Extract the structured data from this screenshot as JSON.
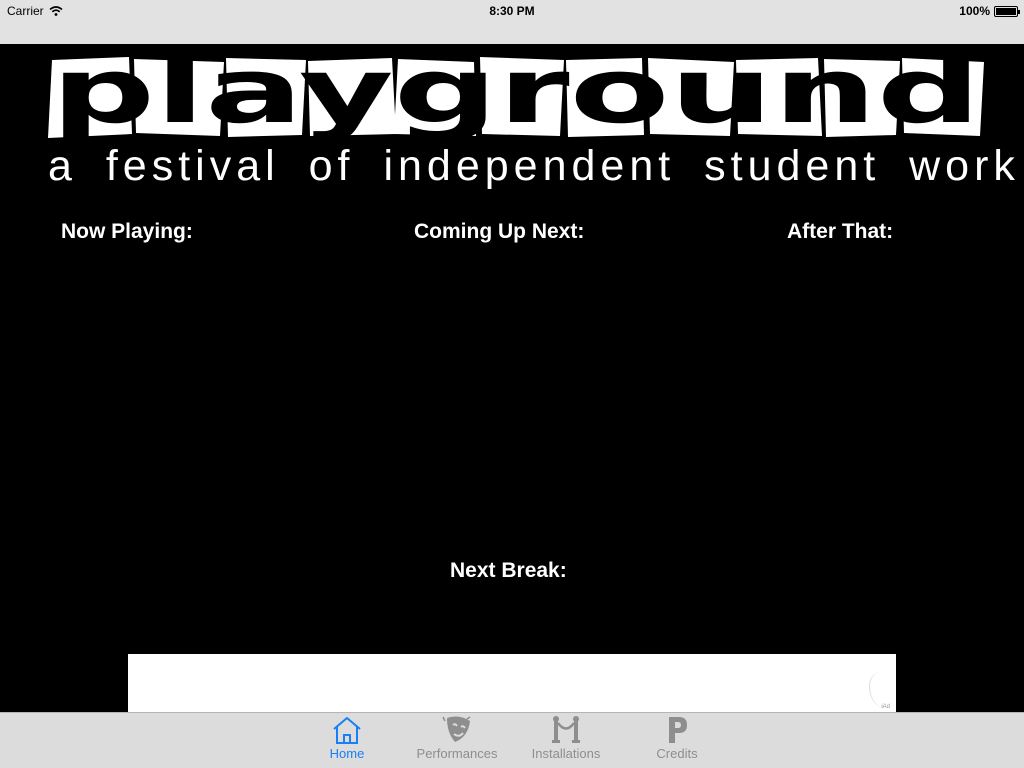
{
  "status_bar": {
    "carrier": "Carrier",
    "time": "8:30 PM",
    "battery": "100%"
  },
  "header": {
    "logo_text": "playground",
    "tagline": "a festival of independent student work"
  },
  "sections": {
    "now_playing": "Now Playing:",
    "coming_up_next": "Coming Up Next:",
    "after_that": "After That:",
    "next_break": "Next Break:"
  },
  "ad_banner": {
    "mark": "iAd"
  },
  "tab_bar": {
    "active": "Home",
    "tabs": [
      {
        "label": "Home",
        "icon": "home-icon"
      },
      {
        "label": "Performances",
        "icon": "theater-masks-icon"
      },
      {
        "label": "Installations",
        "icon": "rope-barrier-icon"
      },
      {
        "label": "Credits",
        "icon": "letter-p-icon"
      }
    ]
  },
  "colors": {
    "accent": "#1a7ff5",
    "inactive": "#8e8e8e",
    "background": "#000000",
    "bar": "#dcdcdc"
  }
}
